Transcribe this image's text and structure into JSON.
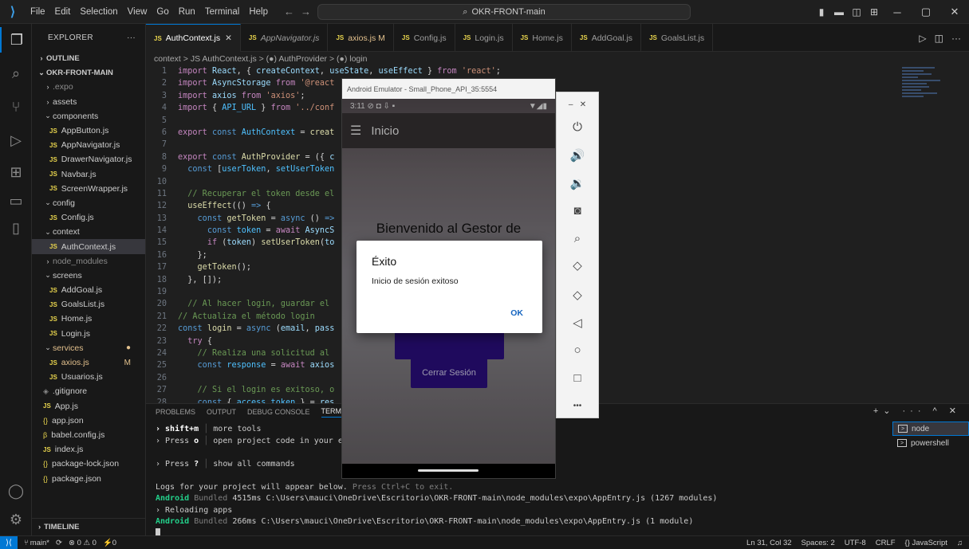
{
  "titlebar": {
    "menu": [
      "File",
      "Edit",
      "Selection",
      "View",
      "Go",
      "Run",
      "Terminal",
      "Help"
    ],
    "search": "OKR-FRONT-main"
  },
  "sidebar": {
    "title": "EXPLORER",
    "sections": {
      "outline": "OUTLINE",
      "project": "OKR-FRONT-MAIN",
      "timeline": "TIMELINE"
    },
    "items": [
      {
        "label": ".expo",
        "type": "folder",
        "depth": 1,
        "dim": true
      },
      {
        "label": "assets",
        "type": "folder",
        "depth": 1
      },
      {
        "label": "components",
        "type": "folder-open",
        "depth": 1
      },
      {
        "label": "AppButton.js",
        "type": "js",
        "depth": 2
      },
      {
        "label": "AppNavigator.js",
        "type": "js",
        "depth": 2
      },
      {
        "label": "DrawerNavigator.js",
        "type": "js",
        "depth": 2
      },
      {
        "label": "Navbar.js",
        "type": "js",
        "depth": 2
      },
      {
        "label": "ScreenWrapper.js",
        "type": "js",
        "depth": 2
      },
      {
        "label": "config",
        "type": "folder-open",
        "depth": 1
      },
      {
        "label": "Config.js",
        "type": "js",
        "depth": 2
      },
      {
        "label": "context",
        "type": "folder-open",
        "depth": 1
      },
      {
        "label": "AuthContext.js",
        "type": "js",
        "depth": 2,
        "selected": true
      },
      {
        "label": "node_modules",
        "type": "folder",
        "depth": 1,
        "dim": true
      },
      {
        "label": "screens",
        "type": "folder-open",
        "depth": 1
      },
      {
        "label": "AddGoal.js",
        "type": "js",
        "depth": 2
      },
      {
        "label": "GoalsList.js",
        "type": "js",
        "depth": 2
      },
      {
        "label": "Home.js",
        "type": "js",
        "depth": 2
      },
      {
        "label": "Login.js",
        "type": "js",
        "depth": 2
      },
      {
        "label": "services",
        "type": "folder-open",
        "depth": 1,
        "mod": true,
        "badge": "●"
      },
      {
        "label": "axios.js",
        "type": "js",
        "depth": 2,
        "mod": true,
        "badge": "M"
      },
      {
        "label": "Usuarios.js",
        "type": "js",
        "depth": 2
      },
      {
        "label": ".gitignore",
        "type": "git",
        "depth": 1
      },
      {
        "label": "App.js",
        "type": "js",
        "depth": 1
      },
      {
        "label": "app.json",
        "type": "json",
        "depth": 1
      },
      {
        "label": "babel.config.js",
        "type": "babel",
        "depth": 1
      },
      {
        "label": "index.js",
        "type": "js",
        "depth": 1
      },
      {
        "label": "package-lock.json",
        "type": "json",
        "depth": 1
      },
      {
        "label": "package.json",
        "type": "json",
        "depth": 1
      }
    ]
  },
  "tabs": [
    {
      "label": "AuthContext.js",
      "active": true
    },
    {
      "label": "AppNavigator.js",
      "italic": true
    },
    {
      "label": "axios.js M",
      "mod": true
    },
    {
      "label": "Config.js"
    },
    {
      "label": "Login.js"
    },
    {
      "label": "Home.js"
    },
    {
      "label": "AddGoal.js"
    },
    {
      "label": "GoalsList.js"
    }
  ],
  "breadcrumb": "context > JS AuthContext.js > (●) AuthProvider > (●) login",
  "code_lines": [
    {
      "n": "1",
      "html": "<span class=\"kw\">import</span> <span class=\"var\">React</span>, { <span class=\"var\">createContext</span>, <span class=\"var\">useState</span>, <span class=\"var\">useEffect</span> } <span class=\"kw\">from</span> <span class=\"str\">'react'</span>;"
    },
    {
      "n": "2",
      "html": "<span class=\"kw\">import</span> <span class=\"var\">AsyncStorage</span> <span class=\"kw\">from</span> <span class=\"str\">'@react</span>"
    },
    {
      "n": "3",
      "html": "<span class=\"kw\">import</span> <span class=\"var\">axios</span> <span class=\"kw\">from</span> <span class=\"str\">'axios'</span>;"
    },
    {
      "n": "4",
      "html": "<span class=\"kw\">import</span> { <span class=\"cnst\">API_URL</span> } <span class=\"kw\">from</span> <span class=\"str\">'../conf</span>"
    },
    {
      "n": "5",
      "html": ""
    },
    {
      "n": "6",
      "html": "<span class=\"kw\">export</span> <span class=\"kb\">const</span> <span class=\"cnst\">AuthContext</span> = <span class=\"fn\">creat</span>"
    },
    {
      "n": "7",
      "html": ""
    },
    {
      "n": "8",
      "html": "<span class=\"kw\">export</span> <span class=\"kb\">const</span> <span class=\"fn\">AuthProvider</span> = ({ <span class=\"var\">c</span>"
    },
    {
      "n": "9",
      "html": "  <span class=\"kb\">const</span> [<span class=\"cnst\">userToken</span>, <span class=\"cnst\">setUserToken</span>"
    },
    {
      "n": "10",
      "html": ""
    },
    {
      "n": "11",
      "html": "  <span class=\"cmt\">// Recuperar el token desde el</span>"
    },
    {
      "n": "12",
      "html": "  <span class=\"fn\">useEffect</span>(() <span class=\"kb\">=&gt;</span> {"
    },
    {
      "n": "13",
      "html": "    <span class=\"kb\">const</span> <span class=\"fn\">getToken</span> = <span class=\"kb\">async</span> () <span class=\"kb\">=&gt;</span>"
    },
    {
      "n": "14",
      "html": "      <span class=\"kb\">const</span> <span class=\"cnst\">token</span> = <span class=\"kw\">await</span> <span class=\"var\">AsyncS</span>"
    },
    {
      "n": "15",
      "html": "      <span class=\"kw\">if</span> (<span class=\"var\">token</span>) <span class=\"fn\">setUserToken</span>(<span class=\"var\">to</span>"
    },
    {
      "n": "16",
      "html": "    };"
    },
    {
      "n": "17",
      "html": "    <span class=\"fn\">getToken</span>();"
    },
    {
      "n": "18",
      "html": "  }, []);"
    },
    {
      "n": "19",
      "html": ""
    },
    {
      "n": "20",
      "html": "  <span class=\"cmt\">// Al hacer login, guardar el</span>"
    },
    {
      "n": "21",
      "html": "<span class=\"cmt\">// Actualiza el método login</span>"
    },
    {
      "n": "22",
      "html": "<span class=\"kb\">const</span> <span class=\"fn\">login</span> = <span class=\"kb\">async</span> (<span class=\"var\">email</span>, <span class=\"var\">pass</span>"
    },
    {
      "n": "23",
      "html": "  <span class=\"kw\">try</span> {"
    },
    {
      "n": "24",
      "html": "    <span class=\"cmt\">// Realiza una solicitud al</span>"
    },
    {
      "n": "25",
      "html": "    <span class=\"kb\">const</span> <span class=\"cnst\">response</span> = <span class=\"kw\">await</span> <span class=\"var\">axios</span>"
    },
    {
      "n": "26",
      "html": ""
    },
    {
      "n": "27",
      "html": "    <span class=\"cmt\">// Si el login es exitoso, o</span>"
    },
    {
      "n": "28",
      "html": "    <span class=\"kb\">const</span> { <span class=\"cnst\">access_token</span> } = <span class=\"var\">res</span>"
    }
  ],
  "panel": {
    "tabs": [
      "PROBLEMS",
      "OUTPUT",
      "DEBUG CONSOLE",
      "TERMINAL"
    ],
    "terminals": [
      "node",
      "powershell"
    ],
    "lines": [
      "<span class=\"b\">› shift+m</span> <span class=\"sep\">│</span> more tools",
      "› Press <span class=\"b\">o</span> <span class=\"sep\">│</span> open project code in your edi",
      "",
      "› Press <span class=\"b\">?</span> <span class=\"sep\">│</span> show all commands",
      "",
      "Logs for your project will appear below. <span class=\"dim\">Press Ctrl+C to exit.</span>",
      "<span class=\"g\">Android</span> <span class=\"dim\">Bundled</span> 4515ms C:\\Users\\mauci\\OneDrive\\Escritorio\\OKR-FRONT-main\\node_modules\\expo\\AppEntry.js (1267 modules)",
      "› Reloading apps",
      "<span class=\"g\">Android</span> <span class=\"dim\">Bundled</span> 266ms C:\\Users\\mauci\\OneDrive\\Escritorio\\OKR-FRONT-main\\node_modules\\expo\\AppEntry.js (1 module)"
    ]
  },
  "statusbar": {
    "branch": "main*",
    "sync": "⟳",
    "problems": "⊗ 0 ⚠ 0",
    "ports": "⚡0",
    "position": "Ln 31, Col 32",
    "spaces": "Spaces: 2",
    "encoding": "UTF-8",
    "eol": "CRLF",
    "language": "{} JavaScript"
  },
  "emulator": {
    "window_title": "Android Emulator - Small_Phone_API_35:5554",
    "time": "3:11",
    "app_title": "Inicio",
    "welcome": "Bienvenido al Gestor de",
    "button_logout": "Cerrar Sesión",
    "dialog": {
      "title": "Éxito",
      "message": "Inicio de sesión exitoso",
      "ok": "OK"
    }
  }
}
